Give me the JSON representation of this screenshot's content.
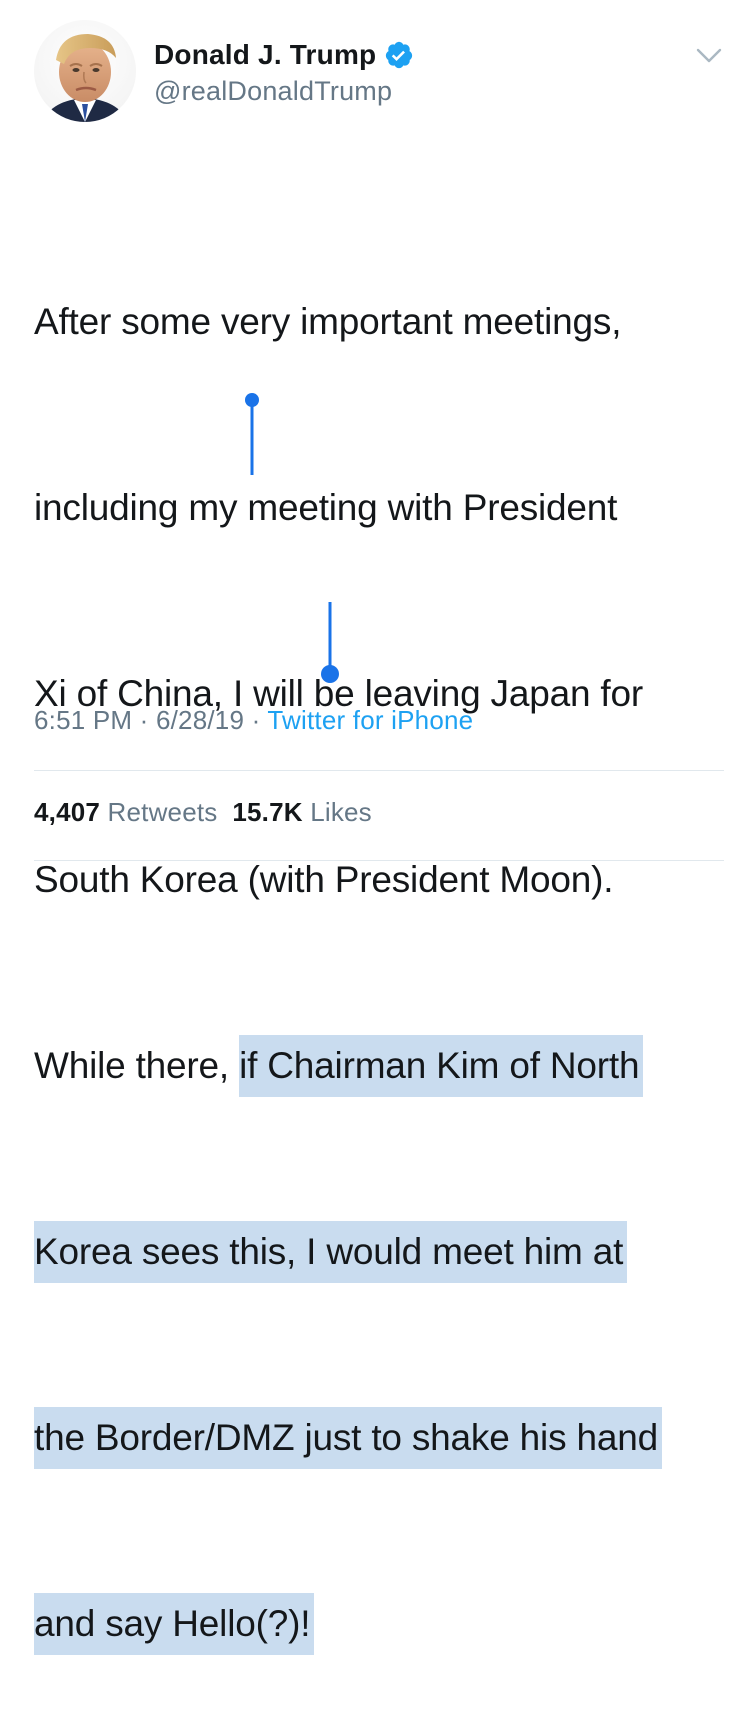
{
  "user": {
    "display_name": "Donald J. Trump",
    "handle": "@realDonaldTrump",
    "verified": true,
    "avatar_icon": "profile-photo"
  },
  "menu": {
    "icon": "chevron-down-icon"
  },
  "tweet": {
    "line1": "After some very important meetings,",
    "line2": "including my meeting with President",
    "line3": "Xi of China, I will be leaving Japan for",
    "line4": "South Korea (with President Moon).",
    "line5_unselected": "While there, ",
    "line5_selected": "if Chairman Kim of North",
    "line6_selected": "Korea sees this, I would meet him at",
    "line7_selected": "the Border/DMZ just to shake his hand",
    "line8_selected": "and say Hello(?)!"
  },
  "meta": {
    "time": "6:51 PM",
    "separator": "·",
    "date": "6/28/19",
    "source": "Twitter for iPhone"
  },
  "stats": {
    "retweets_count": "4,407",
    "retweets_label": "Retweets",
    "likes_count": "15.7K",
    "likes_label": "Likes"
  },
  "colors": {
    "verified_blue": "#1da1f2",
    "selection_highlight": "#c9dcef",
    "selection_handle": "#1a73e8",
    "secondary_text": "#657786"
  }
}
